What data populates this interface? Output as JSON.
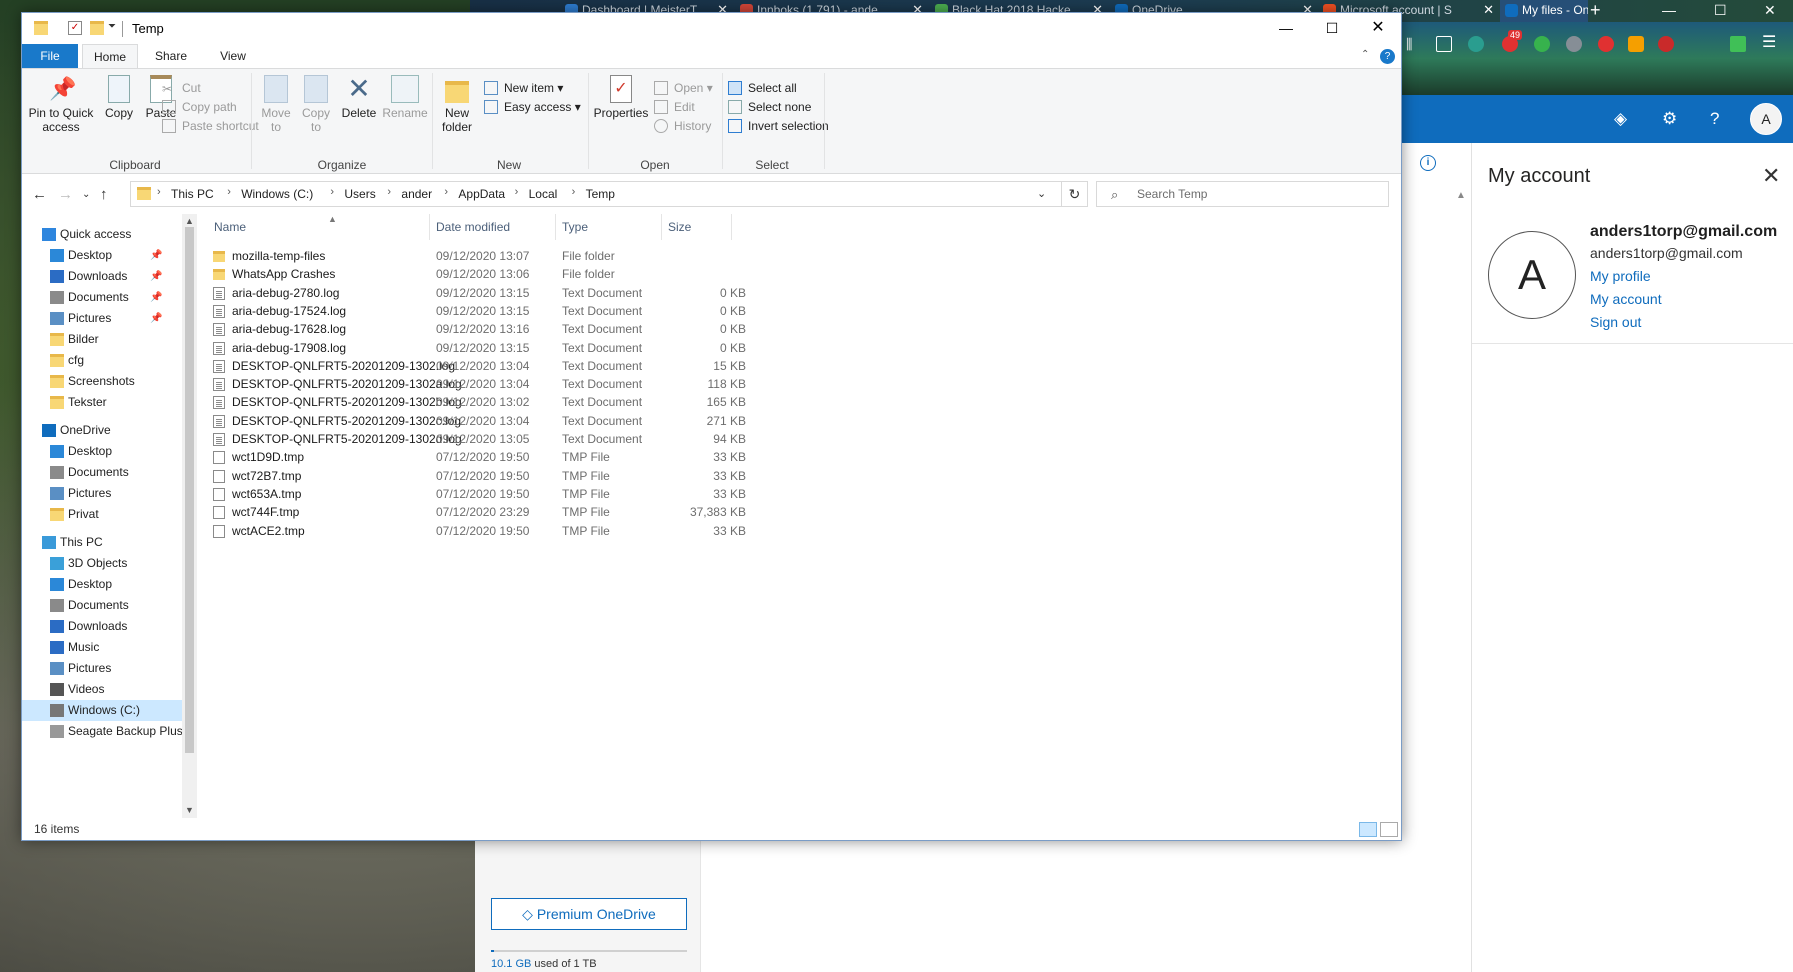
{
  "browser": {
    "tabs": [
      {
        "label": "Dashboard | MeisterT",
        "color": "#2e7dd1"
      },
      {
        "label": "Innboks (1 791) - ande",
        "color": "#d44638"
      },
      {
        "label": "Black Hat 2018 Hacke",
        "color": "#4caf50"
      },
      {
        "label": "OneDrive",
        "color": "#0f6cbd"
      },
      {
        "label": "Microsoft account | S",
        "color": "#f25022"
      },
      {
        "label": "My files - OneDrive",
        "color": "#0f6cbd",
        "active": true
      }
    ],
    "new_tab": "+",
    "badge_count": "49"
  },
  "onedrive": {
    "avatar_letter": "A",
    "premium_label": "Premium OneDrive",
    "storage_used": "10.1 GB",
    "storage_rest": " used of 1 TB",
    "account_panel": {
      "title": "My account",
      "avatar_letter": "A",
      "name": "anders1torp@gmail.com",
      "email": "anders1torp@gmail.com",
      "links": [
        "My profile",
        "My account",
        "Sign out"
      ]
    }
  },
  "explorer": {
    "title": "Temp",
    "ribbon_tabs": [
      "File",
      "Home",
      "Share",
      "View"
    ],
    "ribbon": {
      "clipboard": {
        "label": "Clipboard",
        "pin": "Pin to Quick access",
        "copy": "Copy",
        "paste": "Paste",
        "cut": "Cut",
        "copy_path": "Copy path",
        "paste_shortcut": "Paste shortcut"
      },
      "organize": {
        "label": "Organize",
        "move_to": "Move to",
        "copy_to": "Copy to",
        "delete": "Delete",
        "rename": "Rename"
      },
      "new": {
        "label": "New",
        "new_folder": "New folder",
        "new_item": "New item",
        "easy_access": "Easy access"
      },
      "open": {
        "label": "Open",
        "properties": "Properties",
        "open": "Open",
        "edit": "Edit",
        "history": "History"
      },
      "select": {
        "label": "Select",
        "select_all": "Select all",
        "select_none": "Select none",
        "invert": "Invert selection"
      }
    },
    "breadcrumb": [
      "This PC",
      "Windows (C:)",
      "Users",
      "ander",
      "AppData",
      "Local",
      "Temp"
    ],
    "search_placeholder": "Search Temp",
    "nav": [
      {
        "label": "Quick access",
        "level": 0,
        "icon": "star-icon",
        "color": "#2e86de"
      },
      {
        "label": "Desktop",
        "level": 1,
        "icon": "desktop-icon",
        "color": "#2b88d8",
        "pinned": true
      },
      {
        "label": "Downloads",
        "level": 1,
        "icon": "download-icon",
        "color": "#2b6cc4",
        "pinned": true
      },
      {
        "label": "Documents",
        "level": 1,
        "icon": "documents-icon",
        "color": "#8a8a8a",
        "pinned": true
      },
      {
        "label": "Pictures",
        "level": 1,
        "icon": "pictures-icon",
        "color": "#5a8fc4",
        "pinned": true
      },
      {
        "label": "Bilder",
        "level": 1,
        "icon": "folder-icon",
        "color": "#f8d775"
      },
      {
        "label": "cfg",
        "level": 1,
        "icon": "folder-icon",
        "color": "#f8d775"
      },
      {
        "label": "Screenshots",
        "level": 1,
        "icon": "folder-icon",
        "color": "#f8d775"
      },
      {
        "label": "Tekster",
        "level": 1,
        "icon": "folder-icon",
        "color": "#f8d775"
      },
      {
        "label": "OneDrive",
        "level": 0,
        "icon": "cloud-icon",
        "color": "#0f6cbd"
      },
      {
        "label": "Desktop",
        "level": 1,
        "icon": "desktop-icon",
        "color": "#2b88d8"
      },
      {
        "label": "Documents",
        "level": 1,
        "icon": "documents-icon",
        "color": "#8a8a8a"
      },
      {
        "label": "Pictures",
        "level": 1,
        "icon": "pictures-icon",
        "color": "#5a8fc4"
      },
      {
        "label": "Privat",
        "level": 1,
        "icon": "folder-icon",
        "color": "#f8d775"
      },
      {
        "label": "This PC",
        "level": 0,
        "icon": "computer-icon",
        "color": "#3a9ad9"
      },
      {
        "label": "3D Objects",
        "level": 1,
        "icon": "3d-objects-icon",
        "color": "#3aa0d9"
      },
      {
        "label": "Desktop",
        "level": 1,
        "icon": "desktop-icon",
        "color": "#2b88d8"
      },
      {
        "label": "Documents",
        "level": 1,
        "icon": "documents-icon",
        "color": "#8a8a8a"
      },
      {
        "label": "Downloads",
        "level": 1,
        "icon": "download-icon",
        "color": "#2b6cc4"
      },
      {
        "label": "Music",
        "level": 1,
        "icon": "music-icon",
        "color": "#2b6cc4"
      },
      {
        "label": "Pictures",
        "level": 1,
        "icon": "pictures-icon",
        "color": "#5a8fc4"
      },
      {
        "label": "Videos",
        "level": 1,
        "icon": "videos-icon",
        "color": "#555"
      },
      {
        "label": "Windows (C:)",
        "level": 1,
        "icon": "drive-icon",
        "color": "#777",
        "selected": true
      },
      {
        "label": "Seagate Backup Plus",
        "level": 1,
        "icon": "drive-icon",
        "color": "#999"
      }
    ],
    "columns": [
      "Name",
      "Date modified",
      "Type",
      "Size"
    ],
    "files": [
      {
        "name": "mozilla-temp-files",
        "date": "09/12/2020 13:07",
        "type": "File folder",
        "size": "",
        "kind": "folder"
      },
      {
        "name": "WhatsApp Crashes",
        "date": "09/12/2020 13:06",
        "type": "File folder",
        "size": "",
        "kind": "folder"
      },
      {
        "name": "aria-debug-2780.log",
        "date": "09/12/2020 13:15",
        "type": "Text Document",
        "size": "0 KB",
        "kind": "doc"
      },
      {
        "name": "aria-debug-17524.log",
        "date": "09/12/2020 13:15",
        "type": "Text Document",
        "size": "0 KB",
        "kind": "doc"
      },
      {
        "name": "aria-debug-17628.log",
        "date": "09/12/2020 13:16",
        "type": "Text Document",
        "size": "0 KB",
        "kind": "doc"
      },
      {
        "name": "aria-debug-17908.log",
        "date": "09/12/2020 13:15",
        "type": "Text Document",
        "size": "0 KB",
        "kind": "doc"
      },
      {
        "name": "DESKTOP-QNLFRT5-20201209-1302.log",
        "date": "09/12/2020 13:04",
        "type": "Text Document",
        "size": "15 KB",
        "kind": "doc"
      },
      {
        "name": "DESKTOP-QNLFRT5-20201209-1302a.log",
        "date": "09/12/2020 13:04",
        "type": "Text Document",
        "size": "118 KB",
        "kind": "doc"
      },
      {
        "name": "DESKTOP-QNLFRT5-20201209-1302b.log",
        "date": "09/12/2020 13:02",
        "type": "Text Document",
        "size": "165 KB",
        "kind": "doc"
      },
      {
        "name": "DESKTOP-QNLFRT5-20201209-1302c.log",
        "date": "09/12/2020 13:04",
        "type": "Text Document",
        "size": "271 KB",
        "kind": "doc"
      },
      {
        "name": "DESKTOP-QNLFRT5-20201209-1302d.log",
        "date": "09/12/2020 13:05",
        "type": "Text Document",
        "size": "94 KB",
        "kind": "doc"
      },
      {
        "name": "wct1D9D.tmp",
        "date": "07/12/2020 19:50",
        "type": "TMP File",
        "size": "33 KB",
        "kind": "tmp"
      },
      {
        "name": "wct72B7.tmp",
        "date": "07/12/2020 19:50",
        "type": "TMP File",
        "size": "33 KB",
        "kind": "tmp"
      },
      {
        "name": "wct653A.tmp",
        "date": "07/12/2020 19:50",
        "type": "TMP File",
        "size": "33 KB",
        "kind": "tmp"
      },
      {
        "name": "wct744F.tmp",
        "date": "07/12/2020 23:29",
        "type": "TMP File",
        "size": "37,383 KB",
        "kind": "tmp"
      },
      {
        "name": "wctACE2.tmp",
        "date": "07/12/2020 19:50",
        "type": "TMP File",
        "size": "33 KB",
        "kind": "tmp"
      }
    ],
    "status": "16 items"
  }
}
